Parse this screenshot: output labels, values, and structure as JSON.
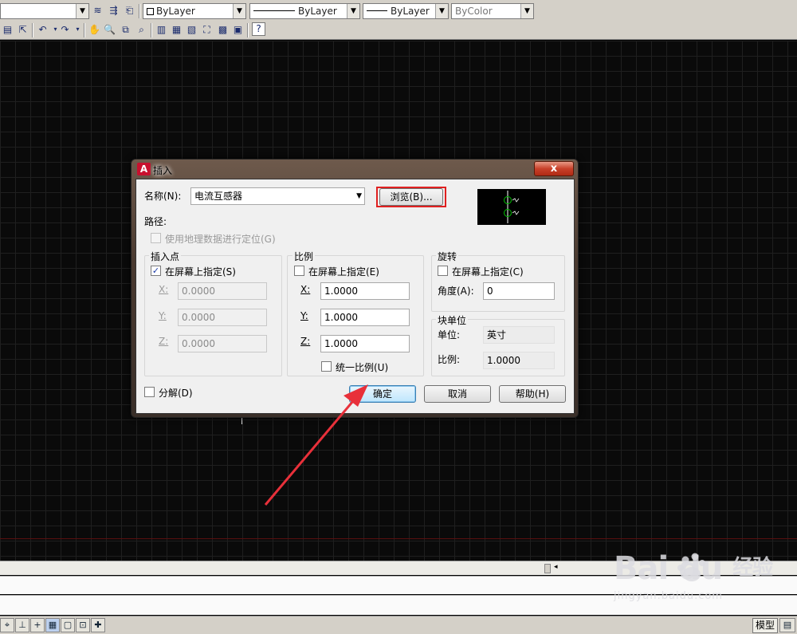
{
  "toolbar": {
    "layer_combo": "",
    "color_combo": "ByLayer",
    "linetype_combo": "ByLayer",
    "lineweight_combo": "ByLayer",
    "plotstyle_combo": "ByColor"
  },
  "dialog": {
    "title": "插入",
    "close_label": "x",
    "app_icon_letter": "A",
    "name_label": "名称(N):",
    "name_value": "电流互感器",
    "browse_label": "浏览(B)...",
    "path_label": "路径:",
    "geo_label": "使用地理数据进行定位(G)",
    "insert_point": {
      "title": "插入点",
      "onscreen_label": "在屏幕上指定(S)",
      "onscreen_checked": true,
      "x_label": "X:",
      "x_value": "0.0000",
      "y_label": "Y:",
      "y_value": "0.0000",
      "z_label": "Z:",
      "z_value": "0.0000"
    },
    "scale": {
      "title": "比例",
      "onscreen_label": "在屏幕上指定(E)",
      "onscreen_checked": false,
      "x_label": "X:",
      "x_value": "1.0000",
      "y_label": "Y:",
      "y_value": "1.0000",
      "z_label": "Z:",
      "z_value": "1.0000",
      "uniform_label": "统一比例(U)"
    },
    "rotation": {
      "title": "旋转",
      "onscreen_label": "在屏幕上指定(C)",
      "angle_label": "角度(A):",
      "angle_value": "0"
    },
    "block_unit": {
      "title": "块单位",
      "unit_label": "单位:",
      "unit_value": "英寸",
      "factor_label": "比例:",
      "factor_value": "1.0000"
    },
    "explode_label": "分解(D)",
    "ok_label": "确定",
    "cancel_label": "取消",
    "help_label": "帮助(H)"
  },
  "statusbar": {
    "model_label": "模型"
  },
  "watermark": {
    "logo": "Bai  du",
    "brand_cn": "经验",
    "url": "jingyan.baidu.com"
  },
  "colors": {
    "annotation_red": "#e02020",
    "arrow_red": "#e8303a",
    "preview_green": "#00c000"
  }
}
